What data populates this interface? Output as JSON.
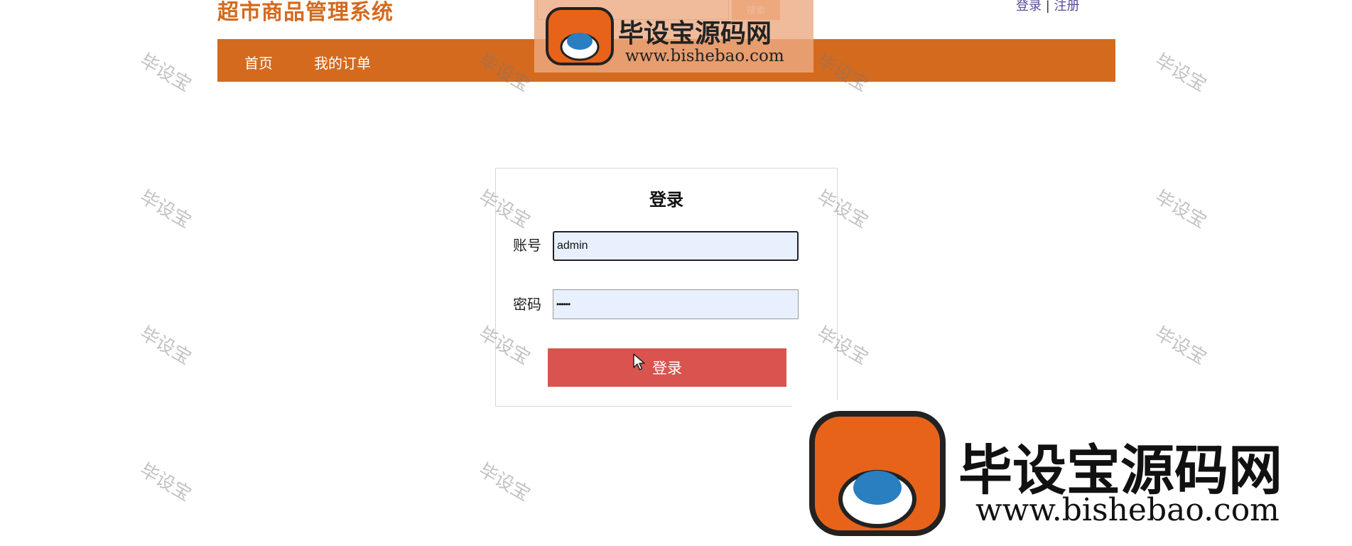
{
  "header": {
    "site_title": "超市商品管理系统",
    "search_label": "搜索",
    "login_link": "登录",
    "separator": "|",
    "register_link": "注册"
  },
  "nav": {
    "items": [
      {
        "label": "首页"
      },
      {
        "label": "我的订单"
      }
    ]
  },
  "login_form": {
    "heading": "登录",
    "account_label": "账号",
    "account_value": "admin",
    "password_label": "密码",
    "password_value": "••••••",
    "submit_label": "登录"
  },
  "watermark": {
    "text": "毕设宝",
    "brand": "毕设宝源码网",
    "url": "www.bishebao.com"
  },
  "colors": {
    "accent": "#d46a1e",
    "button": "#d9534f",
    "input_bg": "#e8f0fe"
  }
}
